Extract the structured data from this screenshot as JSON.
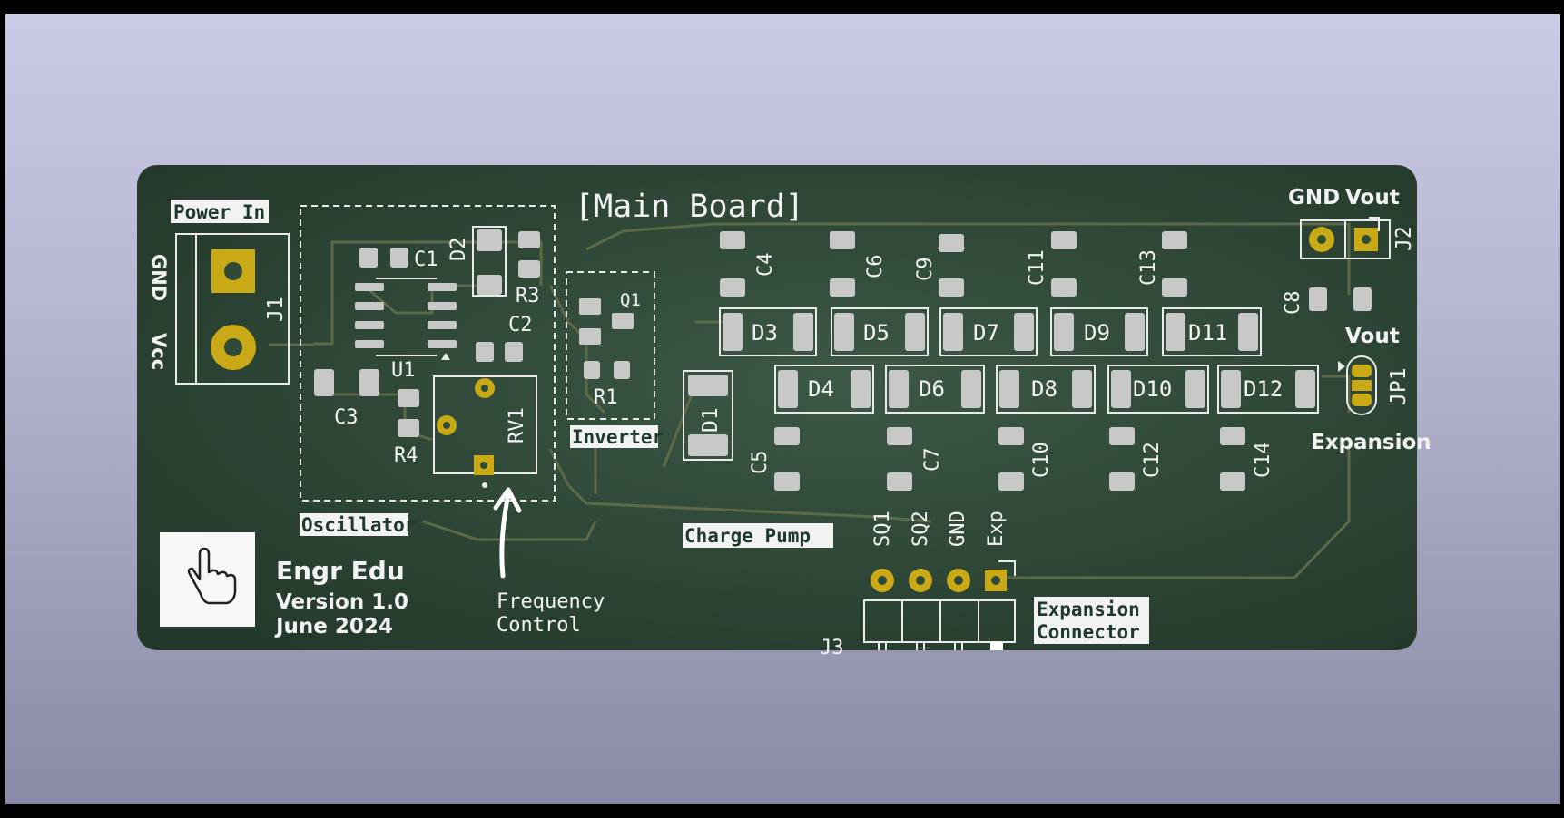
{
  "board": {
    "title": "[Main Board]",
    "sections": {
      "power_in": "Power In",
      "oscillator": "Oscillator",
      "inverter": "Inverter",
      "charge_pump": "Charge Pump",
      "expansion": "Expansion",
      "expansion_connector_line1": "Expansion",
      "expansion_connector_line2": "Connector"
    },
    "power_pins": {
      "gnd": "GND",
      "vcc": "Vcc"
    },
    "vout_pins": {
      "gnd": "GND",
      "vout": "Vout"
    },
    "jumper_label": "Vout",
    "connector_pins": [
      "SQ1",
      "SQ2",
      "GND",
      "Exp"
    ],
    "annotation_line1": "Frequency",
    "annotation_line2": "Control",
    "logo": {
      "icon": "pointer-hand-icon",
      "brand": "Engr Edu",
      "version": "Version 1.0",
      "date": "June 2024"
    },
    "refs": {
      "j1": "J1",
      "j2": "J2",
      "j3": "J3",
      "jp1": "JP1",
      "u1": "U1",
      "q1": "Q1",
      "rv1": "RV1",
      "r1": "R1",
      "r3": "R3",
      "r4": "R4",
      "c1": "C1",
      "c2": "C2",
      "c3": "C3",
      "c4": "C4",
      "c5": "C5",
      "c6": "C6",
      "c7": "C7",
      "c8": "C8",
      "c9": "C9",
      "c10": "C10",
      "c11": "C11",
      "c12": "C12",
      "c13": "C13",
      "c14": "C14",
      "d1": "D1",
      "d2": "D2",
      "d3": "D3",
      "d4": "D4",
      "d5": "D5",
      "d6": "D6",
      "d7": "D7",
      "d8": "D8",
      "d9": "D9",
      "d10": "D10",
      "d11": "D11",
      "d12": "D12"
    },
    "colors": {
      "soldermask": "#2b4332",
      "silkscreen": "#f2f2f2",
      "copper_pad": "#c9a916",
      "smd_pad": "#c8c8c8",
      "trace": "#5d6a48"
    }
  }
}
